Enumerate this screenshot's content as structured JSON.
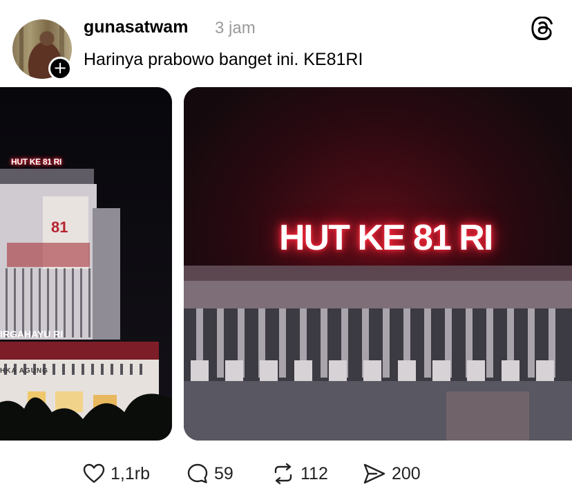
{
  "post": {
    "username": "gunasatwam",
    "timestamp": "3 jam",
    "text": "Harinya prabowo banget ini. KE81RI",
    "follow_icon": "plus-icon",
    "logo_icon": "threads-logo-icon"
  },
  "media": {
    "left_image": {
      "sign_text": "HUT KE 81 RI",
      "banner_text": "IRGAHAYU RI",
      "building_text": "HKA AGUNG"
    },
    "right_image": {
      "sign_text": "HUT KE 81 RI"
    }
  },
  "actions": {
    "likes": {
      "icon": "heart-icon",
      "count": "1,1rb"
    },
    "replies": {
      "icon": "comment-icon",
      "count": "59"
    },
    "reposts": {
      "icon": "repost-icon",
      "count": "112"
    },
    "shares": {
      "icon": "share-icon",
      "count": "200"
    }
  },
  "colors": {
    "neon_red": "#ff2b3e",
    "timestamp_gray": "#9a9a9a"
  }
}
